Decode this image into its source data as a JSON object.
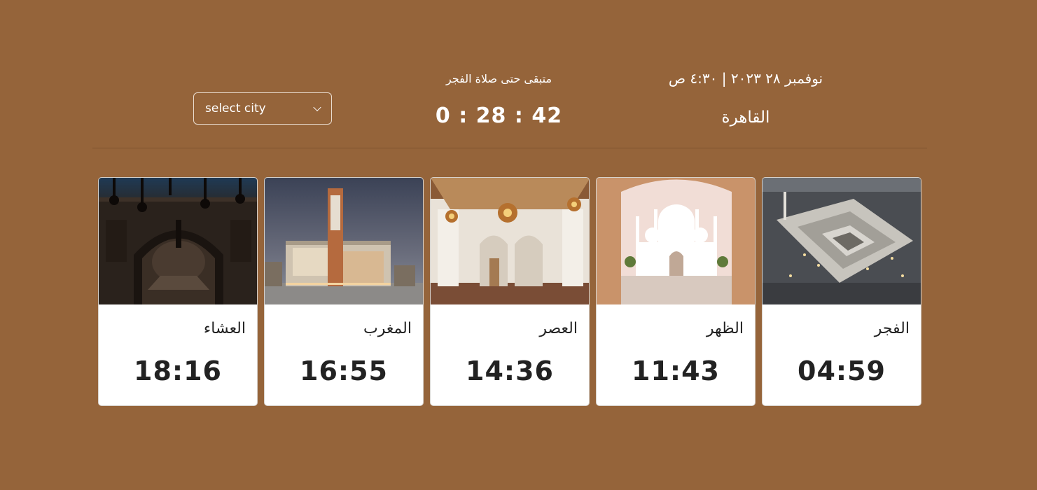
{
  "header": {
    "date_time": "نوفمبر ٢٨ ٢٠٢٣ | ٤:٣٠ ص",
    "city": "القاهرة",
    "remaining_label": "متبقى حتى صلاة الفجر",
    "countdown": "0 : 28 : 42"
  },
  "city_select": {
    "selected": "select city"
  },
  "prayers": [
    {
      "name": "العشاء",
      "time": "18:16",
      "image": "night-mosque-interior-image"
    },
    {
      "name": "المغرب",
      "time": "16:55",
      "image": "modern-mosque-minaret-image"
    },
    {
      "name": "العصر",
      "time": "14:36",
      "image": "ornate-mosque-hall-image"
    },
    {
      "name": "الظهر",
      "time": "11:43",
      "image": "white-domed-mosque-image"
    },
    {
      "name": "الفجر",
      "time": "04:59",
      "image": "aerial-mosque-complex-image"
    }
  ],
  "colors": {
    "background": "#95643a",
    "card": "#ffffff",
    "text_dark": "#222222"
  }
}
